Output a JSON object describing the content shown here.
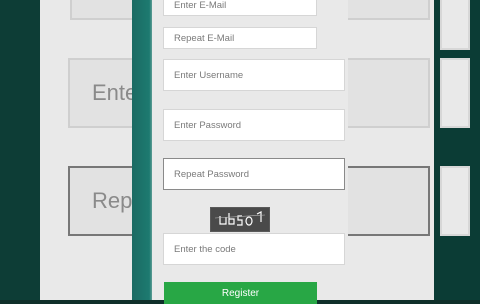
{
  "form": {
    "email_placeholder": "Enter E-Mail",
    "repeat_email_placeholder": "Repeat E-Mail",
    "username_placeholder": "Enter Username",
    "password_placeholder": "Enter Password",
    "repeat_password_placeholder": "Repeat Password",
    "code_placeholder": "Enter the code",
    "register_label": "Register",
    "captcha_text": "UB501"
  },
  "background": {
    "left_label_1": "Ente",
    "left_label_2": "Repe"
  },
  "colors": {
    "teal": "#1d7a70",
    "register_green": "#28a745",
    "field_bg": "#ffffff"
  }
}
